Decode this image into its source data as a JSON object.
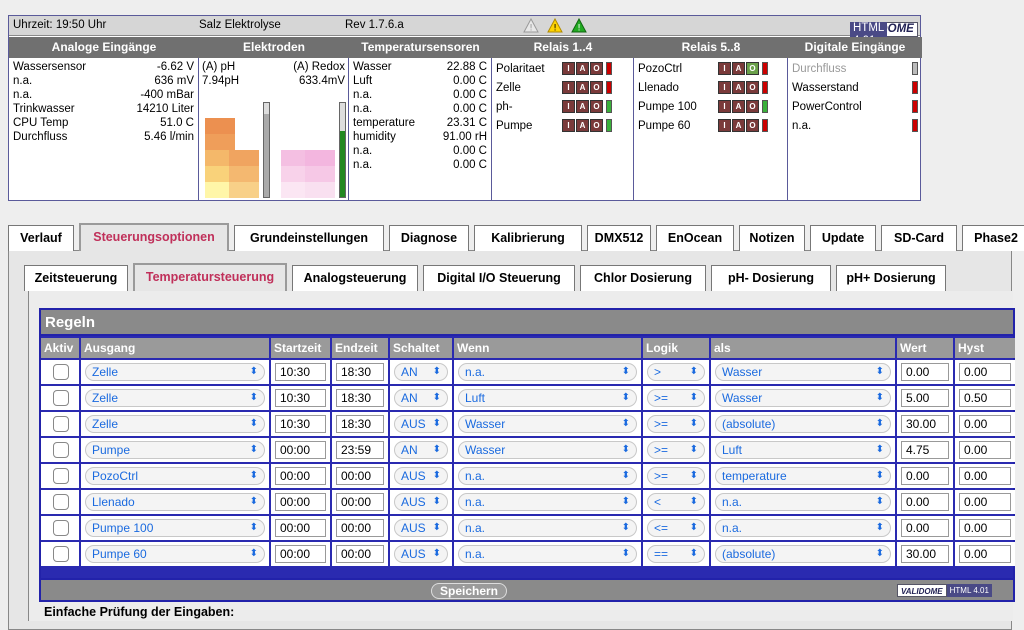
{
  "statusbar": {
    "time": "Uhrzeit: 19:50 Uhr",
    "mode": "Salz Elektrolyse",
    "rev": "Rev 1.7.6.a",
    "badge_a": "VALIDOME",
    "badge_b": "HTML 4.01"
  },
  "sections": {
    "analog": "Analoge Eingänge",
    "electrodes": "Elektroden",
    "temps": "Temperatursensoren",
    "relay14": "Relais 1..4",
    "relay58": "Relais 5..8",
    "digital": "Digitale Eingänge"
  },
  "analog_inputs": [
    {
      "k": "Wassersensor",
      "v": "-6.62 V"
    },
    {
      "k": "n.a.",
      "v": "636 mV"
    },
    {
      "k": "n.a.",
      "v": "-400 mBar"
    },
    {
      "k": "Trinkwasser",
      "v": "14210 Liter"
    },
    {
      "k": "CPU Temp",
      "v": "51.0 C"
    },
    {
      "k": "Durchfluss",
      "v": "5.46 l/min"
    }
  ],
  "electrodes": {
    "ph_label": "(A) pH",
    "ph_value": "7.94pH",
    "redox_label": "(A) Redox",
    "redox_value": "633.4mV",
    "ph_level": 0.88,
    "redox_level": 0.7
  },
  "temperatures": [
    {
      "k": "Wasser",
      "v": "22.88 C"
    },
    {
      "k": "Luft",
      "v": "0.00 C"
    },
    {
      "k": "n.a.",
      "v": "0.00 C"
    },
    {
      "k": "n.a.",
      "v": "0.00 C"
    },
    {
      "k": "temperature",
      "v": "23.31 C"
    },
    {
      "k": "humidity",
      "v": "91.00 rH"
    },
    {
      "k": "n.a.",
      "v": "0.00 C"
    },
    {
      "k": "n.a.",
      "v": "0.00 C"
    }
  ],
  "relays14": [
    {
      "k": "Polaritaet",
      "led": "red"
    },
    {
      "k": "Zelle",
      "led": "red"
    },
    {
      "k": "ph-",
      "led": "green"
    },
    {
      "k": "Pumpe",
      "led": "green"
    }
  ],
  "relays58": [
    {
      "k": "PozoCtrl",
      "led": "red",
      "o_on": true
    },
    {
      "k": "Llenado",
      "led": "red",
      "o_on": false
    },
    {
      "k": "Pumpe 100",
      "led": "green",
      "o_on": false
    },
    {
      "k": "Pumpe 60",
      "led": "red",
      "o_on": false
    }
  ],
  "relay_btn_labels": [
    "I",
    "A",
    "O"
  ],
  "digital_inputs": [
    {
      "k": "Durchfluss",
      "led": "gray"
    },
    {
      "k": "Wasserstand",
      "led": "red"
    },
    {
      "k": "PowerControl",
      "led": "red"
    },
    {
      "k": "n.a.",
      "led": "red"
    }
  ],
  "main_tabs": [
    "Verlauf",
    "Steuerungsoptionen",
    "Grundeinstellungen",
    "Diagnose",
    "Kalibrierung",
    "DMX512",
    "EnOcean",
    "Notizen",
    "Update",
    "SD-Card",
    "Phase2"
  ],
  "sub_tabs": [
    "Zeitsteuerung",
    "Temperatursteuerung",
    "Analogsteuerung",
    "Digital I/O Steuerung",
    "Chlor Dosierung",
    "pH- Dosierung",
    "pH+ Dosierung"
  ],
  "rules": {
    "title": "Regeln",
    "headers": [
      "Aktiv",
      "Ausgang",
      "Startzeit",
      "Endzeit",
      "Schaltet",
      "Wenn",
      "Logik",
      "als",
      "Wert",
      "Hyst"
    ],
    "rows": [
      {
        "ausgang": "Zelle",
        "start": "10:30",
        "end": "18:30",
        "schaltet": "AN",
        "wenn": "n.a.",
        "logik": ">",
        "als": "Wasser",
        "wert": "0.00",
        "hyst": "0.00"
      },
      {
        "ausgang": "Zelle",
        "start": "10:30",
        "end": "18:30",
        "schaltet": "AN",
        "wenn": "Luft",
        "logik": ">=",
        "als": "Wasser",
        "wert": "5.00",
        "hyst": "0.50"
      },
      {
        "ausgang": "Zelle",
        "start": "10:30",
        "end": "18:30",
        "schaltet": "AUS",
        "wenn": "Wasser",
        "logik": ">=",
        "als": "(absolute)",
        "wert": "30.00",
        "hyst": "0.00"
      },
      {
        "ausgang": "Pumpe",
        "start": "00:00",
        "end": "23:59",
        "schaltet": "AN",
        "wenn": "Wasser",
        "logik": ">=",
        "als": "Luft",
        "wert": "4.75",
        "hyst": "0.00"
      },
      {
        "ausgang": "PozoCtrl",
        "start": "00:00",
        "end": "00:00",
        "schaltet": "AUS",
        "wenn": "n.a.",
        "logik": ">=",
        "als": "temperature",
        "wert": "0.00",
        "hyst": "0.00"
      },
      {
        "ausgang": "Llenado",
        "start": "00:00",
        "end": "00:00",
        "schaltet": "AUS",
        "wenn": "n.a.",
        "logik": "<",
        "als": "n.a.",
        "wert": "0.00",
        "hyst": "0.00"
      },
      {
        "ausgang": "Pumpe 100",
        "start": "00:00",
        "end": "00:00",
        "schaltet": "AUS",
        "wenn": "n.a.",
        "logik": "<=",
        "als": "n.a.",
        "wert": "0.00",
        "hyst": "0.00"
      },
      {
        "ausgang": "Pumpe 60",
        "start": "00:00",
        "end": "00:00",
        "schaltet": "AUS",
        "wenn": "n.a.",
        "logik": "==",
        "als": "(absolute)",
        "wert": "30.00",
        "hyst": "0.00"
      }
    ],
    "save_label": "Speichern"
  },
  "bottom_text": "Einfache Prüfung der Eingaben:",
  "colors": {
    "accent_tab": "#c0305a",
    "table_border": "#2222aa",
    "select_text": "#1a6adf"
  }
}
